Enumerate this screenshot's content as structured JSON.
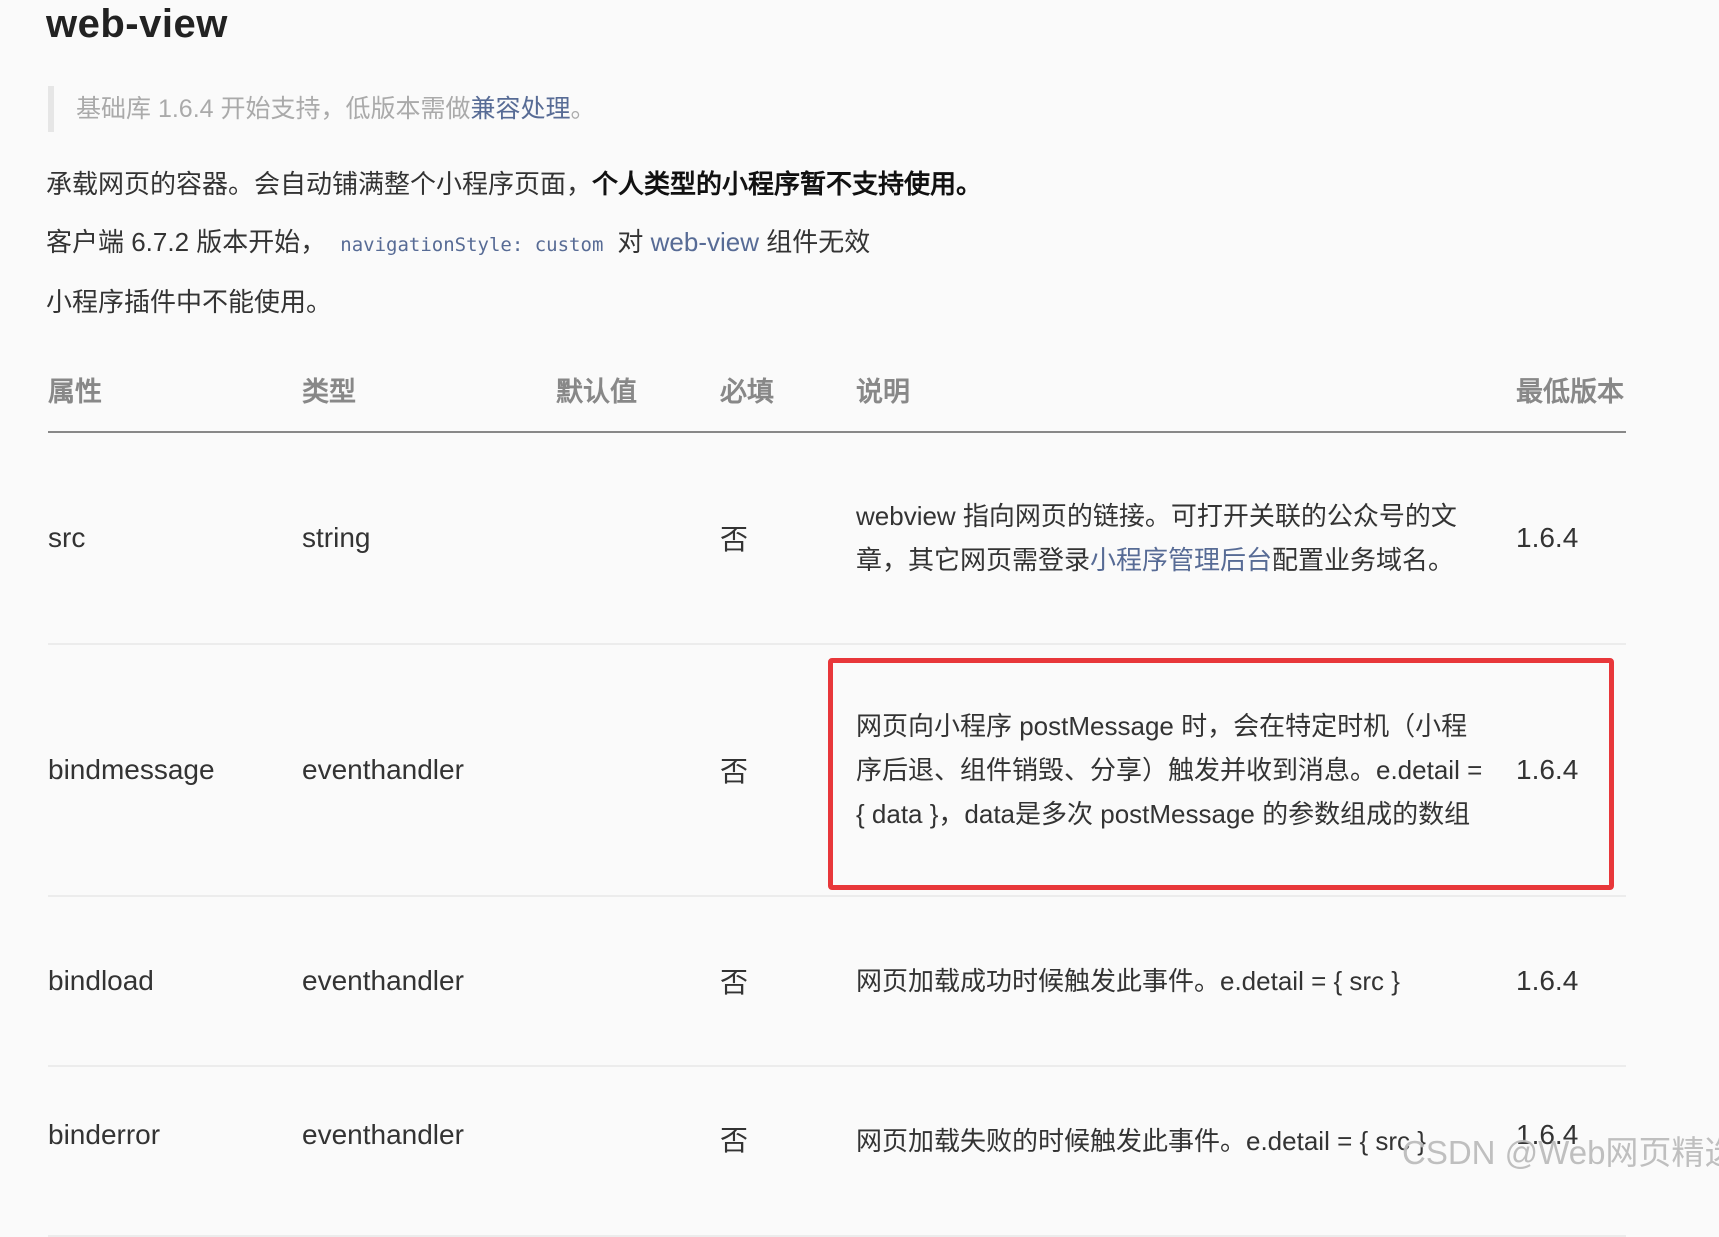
{
  "page": {
    "title": "web-view",
    "notice": {
      "text": "基础库 1.6.4 开始支持，低版本需做",
      "link": "兼容处理",
      "suffix": "。"
    },
    "para1": {
      "text": "承载网页的容器。会自动铺满整个小程序页面，",
      "bold": "个人类型的小程序暂不支持使用。"
    },
    "para2": {
      "prefix": "客户端 6.7.2 版本开始，",
      "code": "navigationStyle: custom",
      "middle": "对",
      "link": "web-view",
      "suffix": "组件无效"
    },
    "para3": "小程序插件中不能使用。"
  },
  "table": {
    "headers": {
      "name": "属性",
      "type": "类型",
      "default": "默认值",
      "required": "必填",
      "desc": "说明",
      "version": "最低版本"
    },
    "rows": [
      {
        "name": "src",
        "type": "string",
        "default": "",
        "required": "否",
        "desc_pre": "webview 指向网页的链接。可打开关联的公众号的文章，其它网页需登录",
        "desc_link": "小程序管理后台",
        "desc_post": "配置业务域名。",
        "version": "1.6.4"
      },
      {
        "name": "bindmessage",
        "type": "eventhandler",
        "default": "",
        "required": "否",
        "desc": "网页向小程序 postMessage 时，会在特定时机（小程序后退、组件销毁、分享）触发并收到消息。e.detail = { data }，data是多次 postMessage 的参数组成的数组",
        "version": "1.6.4"
      },
      {
        "name": "bindload",
        "type": "eventhandler",
        "default": "",
        "required": "否",
        "desc": "网页加载成功时候触发此事件。e.detail = { src }",
        "version": "1.6.4"
      },
      {
        "name": "binderror",
        "type": "eventhandler",
        "default": "",
        "required": "否",
        "desc": "网页加载失败的时候触发此事件。e.detail = { src }",
        "version": "1.6.4"
      }
    ]
  },
  "watermark": "CSDN @Web网页精选",
  "colors": {
    "link": "#576b95",
    "highlight": "#e8373a"
  }
}
